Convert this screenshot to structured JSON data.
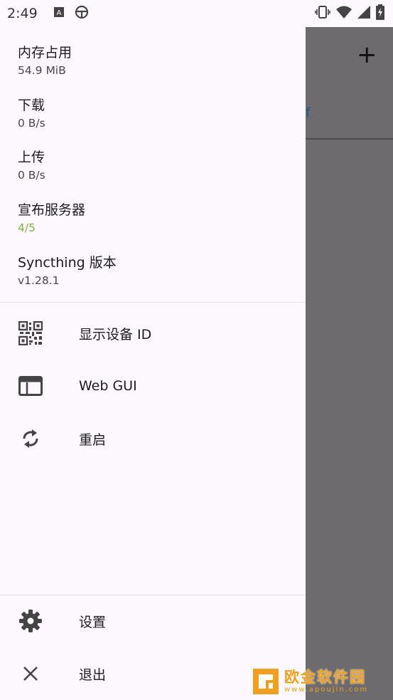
{
  "status_bar": {
    "time": "2:49",
    "left_icons": [
      "a-box-icon",
      "steering-wheel-icon"
    ],
    "right_icons": [
      "vibrate-icon",
      "wifi-icon",
      "signal-icon",
      "battery-charging-icon"
    ]
  },
  "background": {
    "add_icon": "plus-icon",
    "tab_fragment": "f"
  },
  "drawer": {
    "stats": [
      {
        "label": "内存占用",
        "value": "54.9 MiB"
      },
      {
        "label": "下载",
        "value": "0 B/s"
      },
      {
        "label": "上传",
        "value": "0 B/s"
      },
      {
        "label": "宣布服务器",
        "value": "4/5"
      },
      {
        "label": "Syncthing 版本",
        "value": "v1.28.1"
      }
    ],
    "announce_value_color": "#7cb342",
    "menu": [
      {
        "label": "显示设备 ID",
        "icon": "qr-code-icon"
      },
      {
        "label": "Web GUI",
        "icon": "browser-window-icon"
      },
      {
        "label": "重启",
        "icon": "sync-icon"
      }
    ],
    "bottom_menu": [
      {
        "label": "设置",
        "icon": "gear-icon"
      },
      {
        "label": "退出",
        "icon": "close-icon"
      }
    ]
  },
  "watermark": {
    "title": "欧金软件园",
    "url": "www.apoujin.com"
  },
  "colors": {
    "drawer_bg": "#fdf8fd",
    "scrim": "#6d6b6e",
    "watermark": "#f0a020"
  }
}
